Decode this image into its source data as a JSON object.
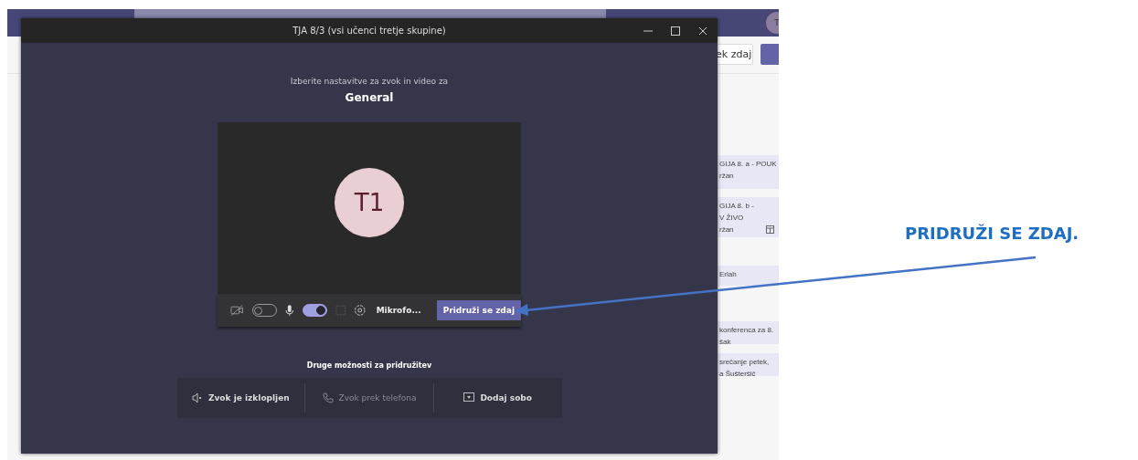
{
  "app": {
    "header_button": "ek zdaj",
    "avatar": "T",
    "events": [
      {
        "lines": [
          "GIJA 8. a - POUK",
          "ržan"
        ],
        "has_icon": false
      },
      {
        "lines": [
          "GIJA 8. b -",
          "V ŽIVO",
          "ržan"
        ],
        "has_icon": true
      },
      {
        "lines": [
          "Erlah"
        ],
        "has_icon": false
      },
      {
        "lines": [
          "konferenca za 8.",
          "šak"
        ],
        "has_icon": false
      },
      {
        "lines": [
          "srečanje petek,",
          "a Šušteršič"
        ],
        "has_icon": false
      }
    ]
  },
  "dialog": {
    "title": "TJA 8/3 (vsi učenci tretje skupine)",
    "prompt": "Izberite nastavitve za zvok in video za",
    "channel": "General",
    "initials": "T1",
    "camera": {
      "on": false
    },
    "microphone": {
      "on": true
    },
    "device": "Mikrofo...",
    "join_button": "Pridruži se zdaj",
    "other_heading": "Druge možnosti za pridružitev",
    "options": [
      {
        "label": "Zvok je izklopljen",
        "kind": "speaker",
        "disabled": false
      },
      {
        "label": "Zvok prek telefona",
        "kind": "phone",
        "disabled": true
      },
      {
        "label": "Dodaj sobo",
        "kind": "room",
        "disabled": false
      }
    ]
  },
  "annotation": {
    "text": "PRIDRUŽI SE ZDAJ."
  }
}
